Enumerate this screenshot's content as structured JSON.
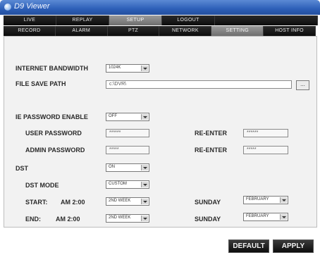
{
  "window": {
    "title": "D9 Viewer"
  },
  "main_tabs": [
    {
      "label": "LIVE"
    },
    {
      "label": "REPLAY"
    },
    {
      "label": "SETUP"
    },
    {
      "label": "LOGOUT"
    }
  ],
  "sub_tabs": [
    {
      "label": "RECORD"
    },
    {
      "label": "ALARM"
    },
    {
      "label": "PTZ"
    },
    {
      "label": "NETWORK"
    },
    {
      "label": "SETTING"
    },
    {
      "label": "HOST INFO"
    }
  ],
  "form": {
    "internet_bandwidth": {
      "label": "INTERNET BANDWIDTH",
      "value": "1024K"
    },
    "file_save_path": {
      "label": "FILE SAVE PATH",
      "value": "c:\\DVR\\",
      "browse_label": "..."
    },
    "ie_password_enable": {
      "label": "IE PASSWORD ENABLE",
      "value": "OFF"
    },
    "user_password": {
      "label": "USER PASSWORD",
      "value": "******",
      "reenter_label": "RE-ENTER",
      "reenter_value": "******"
    },
    "admin_password": {
      "label": "ADMIN PASSWORD",
      "value": "*****",
      "reenter_label": "RE-ENTER",
      "reenter_value": "*****"
    },
    "dst": {
      "label": "DST",
      "value": "ON"
    },
    "dst_mode": {
      "label": "DST MODE",
      "value": "CUSTOM"
    },
    "start": {
      "label": "START:",
      "time": "AM 2:00",
      "week": "2ND WEEK",
      "day": "SUNDAY",
      "month": "FEBRUARY"
    },
    "end": {
      "label": "END:",
      "time": "AM 2:00",
      "week": "2ND WEEK",
      "day": "SUNDAY",
      "month": "FEBRUARY"
    }
  },
  "buttons": {
    "default_label": "DEFAULT",
    "apply_label": "APPLY"
  }
}
